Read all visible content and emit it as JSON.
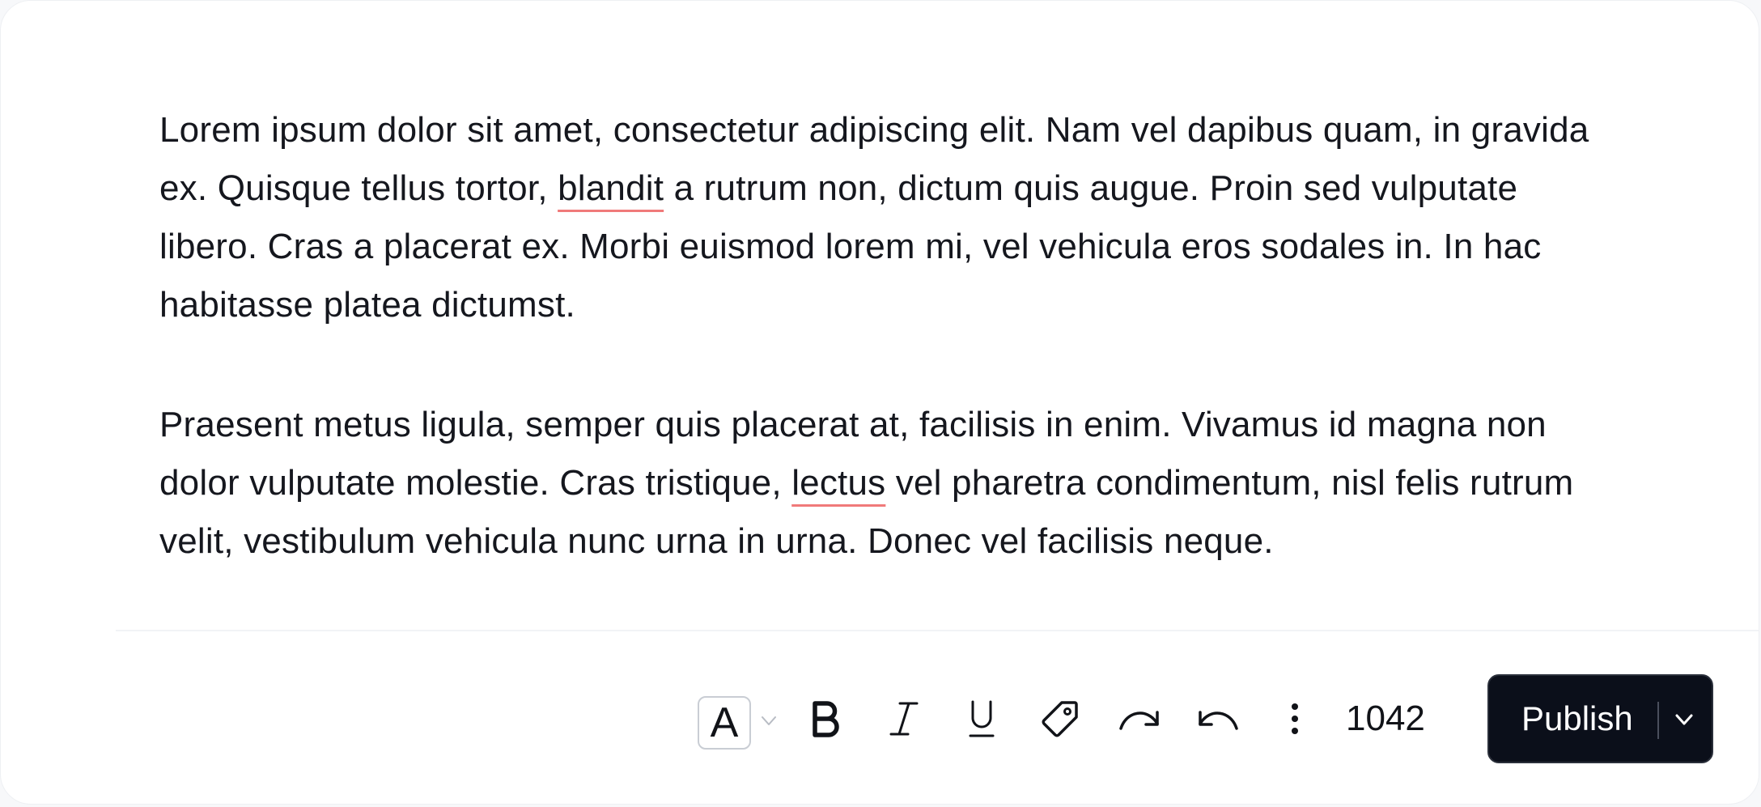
{
  "editor": {
    "paragraphs": [
      {
        "before": "Lorem ipsum dolor sit amet, consectetur adipiscing elit. Nam vel dapibus quam, in gravida ex. Quisque tellus tortor, ",
        "flagged": "blandit",
        "after": " a rutrum non, dictum quis augue. Proin sed vulputate libero. Cras a placerat ex. Morbi euismod lorem mi, vel vehicula eros sodales in. In hac habitasse platea dictumst."
      },
      {
        "before": "Praesent metus ligula, semper quis placerat at, facilisis in enim. Vivamus id magna non dolor vulputate molestie. Cras tristique, ",
        "flagged": "lectus",
        "after": " vel pharetra condimentum, nisl felis rutrum velit, vestibulum vehicula nunc urna in urna. Donec vel facilisis neque."
      }
    ],
    "spellcheck_color": "#f07a7a"
  },
  "toolbar": {
    "font_picker_glyph": "A",
    "word_count": "1042",
    "icons": {
      "bold": "bold-icon",
      "italic": "italic-icon",
      "underline": "underline-icon",
      "tag": "tag-icon",
      "redo": "redo-icon",
      "undo": "undo-icon",
      "more": "more-vertical-icon"
    }
  },
  "publish": {
    "label": "Publish",
    "background": "#0b0f1a"
  }
}
